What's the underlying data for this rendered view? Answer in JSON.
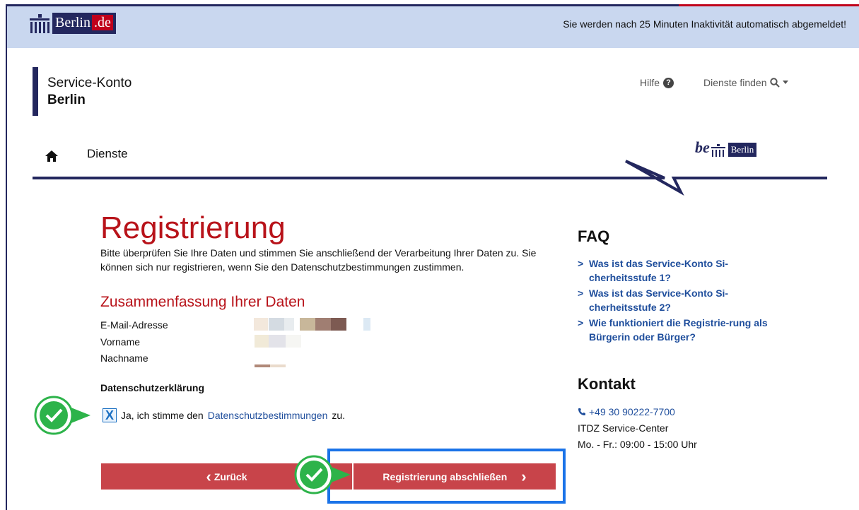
{
  "header": {
    "logo_text": "Berlin",
    "logo_suffix": ".de",
    "session_notice": "Sie werden nach 25 Minuten Inaktivität automatisch abgemeldet!"
  },
  "site": {
    "title_line1": "Service-Konto",
    "title_line2": "Berlin",
    "help_label": "Hilfe",
    "find_services_label": "Dienste finden"
  },
  "nav": {
    "services_label": "Dienste",
    "be_logo_be": "be",
    "be_logo_text": "Berlin"
  },
  "main": {
    "title": "Registrierung",
    "intro": "Bitte überprüfen Sie Ihre Daten und stimmen Sie anschließend der Verarbeitung Ihrer Daten zu. Sie können sich nur registrieren, wenn Sie den Datenschutzbestimmungen zustimmen.",
    "summary_title": "Zusammenfassung Ihrer Daten",
    "fields": {
      "email_label": "E-Mail-Adresse",
      "firstname_label": "Vorname",
      "lastname_label": "Nachname"
    },
    "privacy_title": "Datenschutzerklärung",
    "consent": {
      "checked": true,
      "checkbox_mark": "X",
      "prefix": "Ja, ich stimme den",
      "link": "Datenschutzbestimmungen",
      "suffix": "zu."
    },
    "back_button": "Zurück",
    "back_icon": "‹",
    "finish_button": "Registrierung abschließen",
    "finish_icon": "›"
  },
  "sidebar": {
    "faq_title": "FAQ",
    "faq_items": [
      "Was ist das Service-Konto Si-cherheitsstufe 1?",
      "Was ist das Service-Konto Si-cherheitsstufe 2?",
      "Wie funktioniert die Registrie-rung als Bürgerin oder Bürger?"
    ],
    "contact_title": "Kontakt",
    "phone": "+49 30 90222-7700",
    "service_center": "ITDZ Service-Center",
    "hours": "Mo. - Fr.: 09:00 - 15:00 Uhr"
  },
  "colors": {
    "brand_navy": "#23275e",
    "accent_red": "#b8131a",
    "button_red": "#c8444a",
    "link_blue": "#1f4e9c",
    "highlight_blue": "#1a73e8",
    "badge_green": "#2db34a"
  }
}
